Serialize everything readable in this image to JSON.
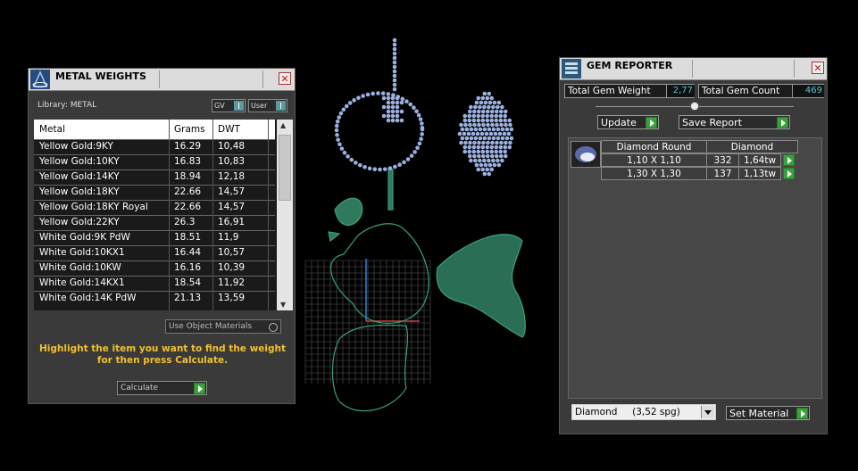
{
  "metal_weights": {
    "title": "METAL WEIGHTS",
    "library_label": "Library: METAL",
    "toggle_gv": "GV",
    "toggle_user": "User",
    "columns": [
      "Metal",
      "Grams",
      "DWT"
    ],
    "rows": [
      [
        "Yellow Gold:9KY",
        "16.29",
        "10,48"
      ],
      [
        "Yellow Gold:10KY",
        "16.83",
        "10,83"
      ],
      [
        "Yellow Gold:14KY",
        "18.94",
        "12,18"
      ],
      [
        "Yellow Gold:18KY",
        "22.66",
        "14,57"
      ],
      [
        "Yellow Gold:18KY Royal",
        "22.66",
        "14,57"
      ],
      [
        "Yellow Gold:22KY",
        "26.3",
        "16,91"
      ],
      [
        "White Gold:9K PdW",
        "18.51",
        "11,9"
      ],
      [
        "White Gold:10KX1",
        "16.44",
        "10,57"
      ],
      [
        "White Gold:10KW",
        "16.16",
        "10,39"
      ],
      [
        "White Gold:14KX1",
        "18.54",
        "11,92"
      ],
      [
        "White Gold:14K PdW",
        "21.13",
        "13,59"
      ]
    ],
    "use_object_materials": "Use Object Materials",
    "hint": "Highlight the item you want to find the weight for then press Calculate.",
    "calculate_label": "Calculate",
    "colors": {
      "hint": "#f0c030",
      "go": "#3aa23a"
    }
  },
  "gem_reporter": {
    "title": "GEM REPORTER",
    "total_weight_label": "Total Gem Weight",
    "total_weight_value": "2,77",
    "total_count_label": "Total Gem Count",
    "total_count_value": "469",
    "update_label": "Update",
    "save_report_label": "Save Report",
    "table_header": [
      "Diamond Round",
      "Diamond"
    ],
    "gems": [
      {
        "size": "1,10 X 1,10",
        "count": "332",
        "weight": "1,64tw"
      },
      {
        "size": "1,30 X 1,30",
        "count": "137",
        "weight": "1,13tw"
      }
    ],
    "material_selected": "Diamond     (3,52 spg)",
    "set_material_label": "Set Material",
    "colors": {
      "value_text": "#4ec9d6"
    }
  }
}
